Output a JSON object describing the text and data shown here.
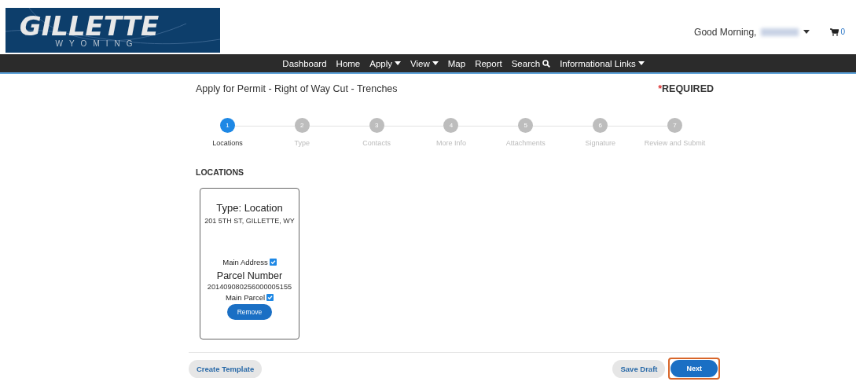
{
  "header": {
    "logo": {
      "title": "GILLETTE",
      "subtitle": "WYOMING"
    },
    "greeting": "Good Morning,",
    "user_name_redacted": true,
    "cart_count": "0"
  },
  "nav": [
    {
      "label": "Dashboard",
      "dropdown": false,
      "search": false
    },
    {
      "label": "Home",
      "dropdown": false,
      "search": false
    },
    {
      "label": "Apply",
      "dropdown": true,
      "search": false
    },
    {
      "label": "View",
      "dropdown": true,
      "search": false
    },
    {
      "label": "Map",
      "dropdown": false,
      "search": false
    },
    {
      "label": "Report",
      "dropdown": false,
      "search": false
    },
    {
      "label": "Search",
      "dropdown": false,
      "search": true
    },
    {
      "label": "Informational Links",
      "dropdown": true,
      "search": false
    }
  ],
  "page": {
    "title": "Apply for Permit - Right of Way Cut - Trenches",
    "required_mark": "*",
    "required_label": "REQUIRED"
  },
  "steps": [
    {
      "number": "1",
      "label": "Locations",
      "selected": true
    },
    {
      "number": "2",
      "label": "Type",
      "selected": false
    },
    {
      "number": "3",
      "label": "Contacts",
      "selected": false
    },
    {
      "number": "4",
      "label": "More Info",
      "selected": false
    },
    {
      "number": "5",
      "label": "Attachments",
      "selected": false
    },
    {
      "number": "6",
      "label": "Signature",
      "selected": false
    },
    {
      "number": "7",
      "label": "Review and Submit",
      "selected": false
    }
  ],
  "section_title": "LOCATIONS",
  "locations": [
    {
      "type_title": "Type: Location",
      "address": "201 5TH ST, GILLETTE, WY",
      "main_address_label": "Main Address",
      "main_address_checked": true,
      "parcel_title": "Parcel Number",
      "parcel_number": "201409080256000005155",
      "main_parcel_label": "Main Parcel",
      "main_parcel_checked": true,
      "remove_label": "Remove"
    }
  ],
  "footer": {
    "create_template": "Create Template",
    "save_draft": "Save Draft",
    "next": "Next",
    "next_highlighted": true
  }
}
